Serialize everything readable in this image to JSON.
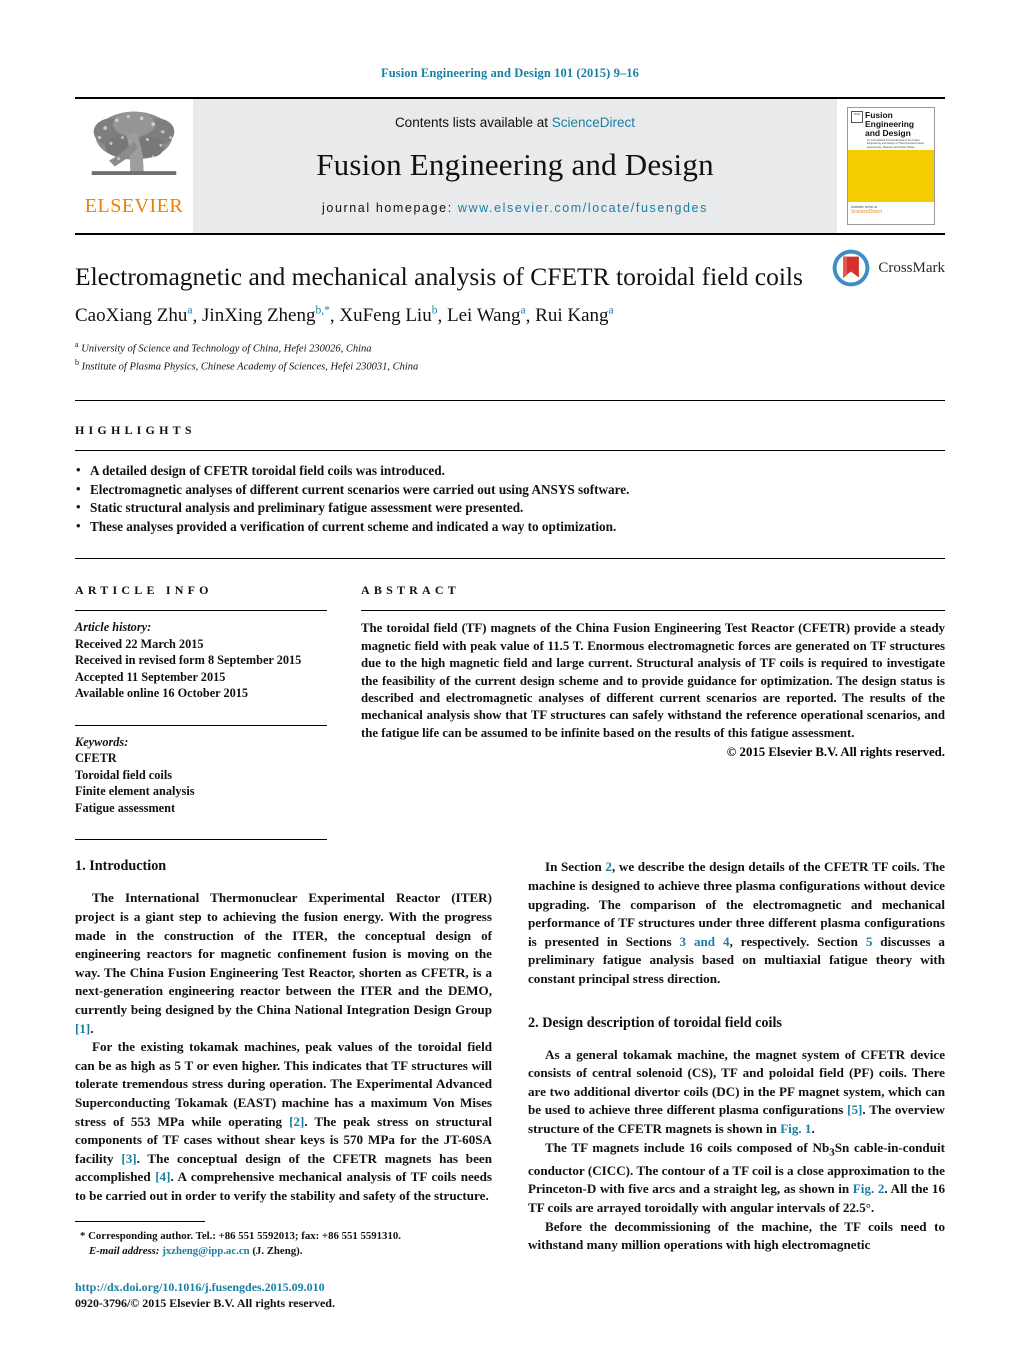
{
  "running_head": "Fusion Engineering and Design 101 (2015) 9–16",
  "masthead": {
    "publisher_name": "ELSEVIER",
    "contents_prefix": "Contents lists available at ",
    "contents_link": "ScienceDirect",
    "journal_title": "Fusion Engineering and Design",
    "homepage_label": "journal homepage: ",
    "homepage_url": "www.elsevier.com/locate/fusengdes",
    "cover": {
      "title_line1": "Fusion Engineering",
      "title_line2": "and Design",
      "subtitle": "An International Journal devoted to the Fusion\nEngineering and Design of Thermonuclear\nFusion Experiments, Reactors and Power Plants",
      "footer_label": "Available online at",
      "footer_brand": "ScienceDirect",
      "footer_url": "www.elsevier.com"
    }
  },
  "article": {
    "title": "Electromagnetic and mechanical analysis of CFETR toroidal field coils",
    "authors": [
      {
        "name": "CaoXiang Zhu",
        "marks": "a",
        "sep": ", "
      },
      {
        "name": "JinXing Zheng",
        "marks": "b,*",
        "sep": ", "
      },
      {
        "name": "XuFeng Liu",
        "marks": "b",
        "sep": ", "
      },
      {
        "name": "Lei Wang",
        "marks": "a",
        "sep": ", "
      },
      {
        "name": "Rui Kang",
        "marks": "a",
        "sep": ""
      }
    ],
    "affiliations": [
      {
        "mark": "a",
        "text": "University of Science and Technology of China, Hefei 230026, China"
      },
      {
        "mark": "b",
        "text": "Institute of Plasma Physics, Chinese Academy of Sciences, Hefei 230031, China"
      }
    ],
    "crossmark_label": "CrossMark"
  },
  "highlights": {
    "heading": "HIGHLIGHTS",
    "items": [
      "A detailed design of CFETR toroidal field coils was introduced.",
      "Electromagnetic analyses of different current scenarios were carried out using ANSYS software.",
      "Static structural analysis and preliminary fatigue assessment were presented.",
      "These analyses provided a verification of current scheme and indicated a way to optimization."
    ]
  },
  "article_info": {
    "heading": "ARTICLE INFO",
    "history_label": "Article history:",
    "history": [
      "Received 22 March 2015",
      "Received in revised form 8 September 2015",
      "Accepted 11 September 2015",
      "Available online 16 October 2015"
    ],
    "keywords_label": "Keywords:",
    "keywords": [
      "CFETR",
      "Toroidal field coils",
      "Finite element analysis",
      "Fatigue assessment"
    ]
  },
  "abstract": {
    "heading": "ABSTRACT",
    "text": "The toroidal field (TF) magnets of the China Fusion Engineering Test Reactor (CFETR) provide a steady magnetic field with peak value of 11.5 T. Enormous electromagnetic forces are generated on TF structures due to the high magnetic field and large current. Structural analysis of TF coils is required to investigate the feasibility of the current design scheme and to provide guidance for optimization. The design status is described and electromagnetic analyses of different current scenarios are reported. The results of the mechanical analysis show that TF structures can safely withstand the reference operational scenarios, and the fatigue life can be assumed to be infinite based on the results of this fatigue assessment.",
    "copyright": "© 2015 Elsevier B.V. All rights reserved."
  },
  "sections": {
    "intro_heading": "1.  Introduction",
    "intro_p1_a": "The International Thermonuclear Experimental Reactor (ITER) project is a giant step to achieving the fusion energy. With the progress made in the construction of the ITER, the conceptual design of engineering reactors for magnetic confinement fusion is moving on the way. The China Fusion Engineering Test Reactor, shorten as CFETR, is a next-generation engineering reactor between the ITER and the DEMO, currently being designed by the China National Integration Design Group ",
    "intro_p1_ref": "[1]",
    "intro_p1_b": ".",
    "intro_p2_a": "For the existing tokamak machines, peak values of the toroidal field can be as high as 5 T or even higher. This indicates that TF structures will tolerate tremendous stress during operation. The Experimental Advanced Superconducting Tokamak (EAST) machine has a maximum Von Mises stress of 553 MPa while operating ",
    "intro_p2_ref1": "[2]",
    "intro_p2_b": ". The peak stress on structural components of TF cases without shear keys is 570 MPa for the JT-60SA facility ",
    "intro_p2_ref2": "[3]",
    "intro_p2_c": ". The conceptual design of the CFETR magnets has been accomplished ",
    "intro_p2_ref3": "[4]",
    "intro_p2_d": ". A comprehensive mechanical analysis of TF coils needs to be carried out in order to verify the stability and safety of the structure.",
    "right_p1_a": "In Section ",
    "right_p1_ref1": "2",
    "right_p1_b": ", we describe the design details of the CFETR TF coils. The machine is designed to achieve three plasma configurations without device upgrading. The comparison of the electromagnetic and mechanical performance of TF structures under three different plasma configurations is presented in Sections ",
    "right_p1_ref2": "3 and 4",
    "right_p1_c": ", respectively. Section ",
    "right_p1_ref3": "5",
    "right_p1_d": " discusses a preliminary fatigue analysis based on multiaxial fatigue theory with constant principal stress direction.",
    "design_heading": "2.  Design description of toroidal field coils",
    "design_p1_a": "As a general tokamak machine, the magnet system of CFETR device consists of central solenoid (CS), TF and poloidal field (PF) coils. There are two additional divertor coils (DC) in the PF magnet system, which can be used to achieve three different plasma configurations ",
    "design_p1_ref1": "[5]",
    "design_p1_b": ". The overview structure of the CFETR magnets is shown in ",
    "design_p1_ref2": "Fig. 1",
    "design_p1_c": ".",
    "design_p2_a": "The TF magnets include 16 coils composed of Nb",
    "design_p2_sub": "3",
    "design_p2_b": "Sn cable-in-conduit conductor (CICC). The contour of a TF coil is a close approximation to the Princeton-D with five arcs and a straight leg, as shown in ",
    "design_p2_ref": "Fig. 2",
    "design_p2_c": ". All the 16 TF coils are arrayed toroidally with angular intervals of 22.5°.",
    "design_p3": "Before the decommissioning of the machine, the TF coils need to withstand many million operations with high electromagnetic"
  },
  "footnote": {
    "star": "*",
    "corresponding": "Corresponding author. Tel.: +86 551 5592013; fax: +86 551 5591310.",
    "email_label": "E-mail address:",
    "email": "jxzheng@ipp.ac.cn",
    "email_suffix": "(J. Zheng)."
  },
  "footer": {
    "doi": "http://dx.doi.org/10.1016/j.fusengdes.2015.09.010",
    "issn": "0920-3796/© 2015 Elsevier B.V. All rights reserved."
  },
  "colors": {
    "link": "#1a7fa5",
    "elsevier_orange": "#f08000",
    "cover_yellow": "#f5cc00",
    "masthead_grey": "#e9eaec"
  }
}
